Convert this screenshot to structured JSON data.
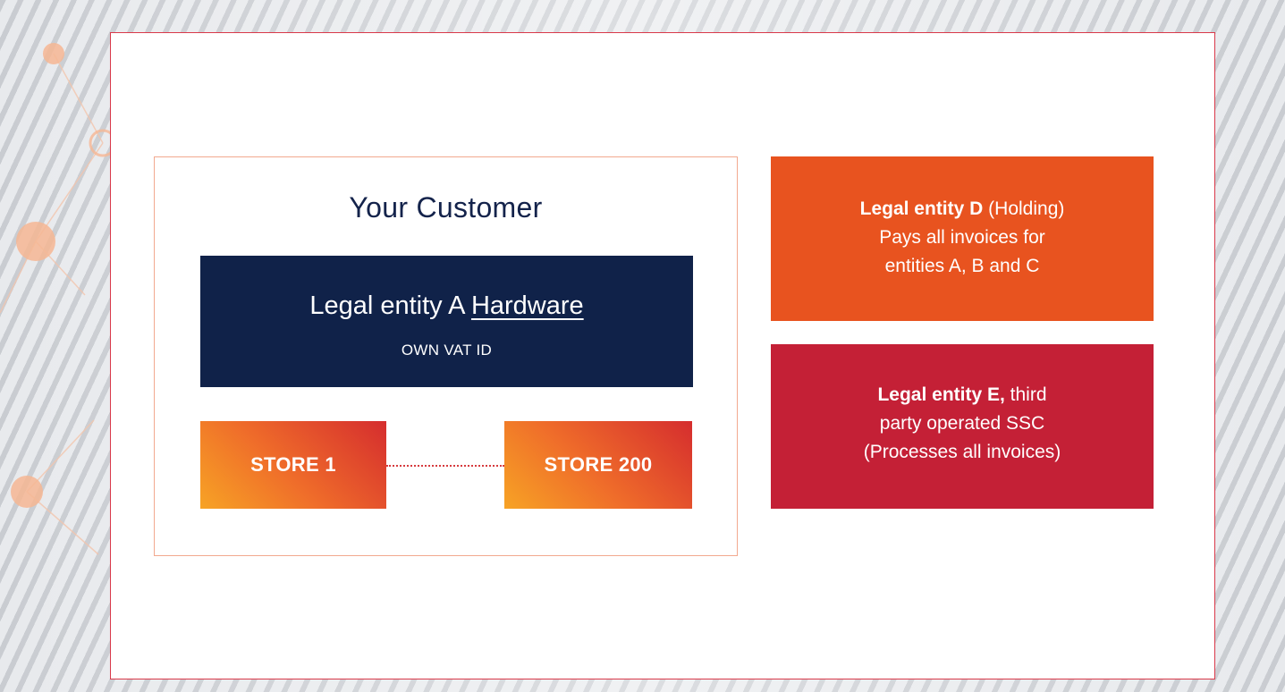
{
  "customer": {
    "title": "Your Customer"
  },
  "entity_a": {
    "label": "Legal entity A",
    "name": "Hardware",
    "subtitle": "OWN VAT ID"
  },
  "stores": {
    "first": "STORE 1",
    "last": "STORE 200"
  },
  "entity_d": {
    "label": "Legal entity D",
    "qualifier": "(Holding)",
    "line2": "Pays all invoices for",
    "line3": "entities A, B and C"
  },
  "entity_e": {
    "label": "Legal entity E,",
    "line1_rest": "third",
    "line2": "party operated SSC",
    "line3": "(Processes all invoices)"
  },
  "colors": {
    "navy": "#102249",
    "orange": "#e8531f",
    "crimson": "#c42036",
    "frame_red": "#d9394a",
    "gradient_start": "#f7a325",
    "gradient_end": "#d52d2e"
  }
}
